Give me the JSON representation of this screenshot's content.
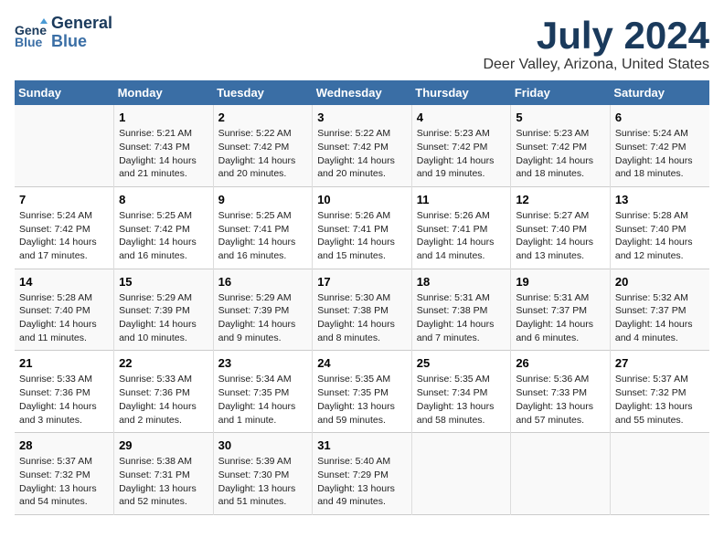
{
  "logo": {
    "line1": "General",
    "line2": "Blue"
  },
  "title": "July 2024",
  "location": "Deer Valley, Arizona, United States",
  "days_header": [
    "Sunday",
    "Monday",
    "Tuesday",
    "Wednesday",
    "Thursday",
    "Friday",
    "Saturday"
  ],
  "weeks": [
    [
      {
        "day": "",
        "sunrise": "",
        "sunset": "",
        "daylight": ""
      },
      {
        "day": "1",
        "sunrise": "Sunrise: 5:21 AM",
        "sunset": "Sunset: 7:43 PM",
        "daylight": "Daylight: 14 hours and 21 minutes."
      },
      {
        "day": "2",
        "sunrise": "Sunrise: 5:22 AM",
        "sunset": "Sunset: 7:42 PM",
        "daylight": "Daylight: 14 hours and 20 minutes."
      },
      {
        "day": "3",
        "sunrise": "Sunrise: 5:22 AM",
        "sunset": "Sunset: 7:42 PM",
        "daylight": "Daylight: 14 hours and 20 minutes."
      },
      {
        "day": "4",
        "sunrise": "Sunrise: 5:23 AM",
        "sunset": "Sunset: 7:42 PM",
        "daylight": "Daylight: 14 hours and 19 minutes."
      },
      {
        "day": "5",
        "sunrise": "Sunrise: 5:23 AM",
        "sunset": "Sunset: 7:42 PM",
        "daylight": "Daylight: 14 hours and 18 minutes."
      },
      {
        "day": "6",
        "sunrise": "Sunrise: 5:24 AM",
        "sunset": "Sunset: 7:42 PM",
        "daylight": "Daylight: 14 hours and 18 minutes."
      }
    ],
    [
      {
        "day": "7",
        "sunrise": "Sunrise: 5:24 AM",
        "sunset": "Sunset: 7:42 PM",
        "daylight": "Daylight: 14 hours and 17 minutes."
      },
      {
        "day": "8",
        "sunrise": "Sunrise: 5:25 AM",
        "sunset": "Sunset: 7:42 PM",
        "daylight": "Daylight: 14 hours and 16 minutes."
      },
      {
        "day": "9",
        "sunrise": "Sunrise: 5:25 AM",
        "sunset": "Sunset: 7:41 PM",
        "daylight": "Daylight: 14 hours and 16 minutes."
      },
      {
        "day": "10",
        "sunrise": "Sunrise: 5:26 AM",
        "sunset": "Sunset: 7:41 PM",
        "daylight": "Daylight: 14 hours and 15 minutes."
      },
      {
        "day": "11",
        "sunrise": "Sunrise: 5:26 AM",
        "sunset": "Sunset: 7:41 PM",
        "daylight": "Daylight: 14 hours and 14 minutes."
      },
      {
        "day": "12",
        "sunrise": "Sunrise: 5:27 AM",
        "sunset": "Sunset: 7:40 PM",
        "daylight": "Daylight: 14 hours and 13 minutes."
      },
      {
        "day": "13",
        "sunrise": "Sunrise: 5:28 AM",
        "sunset": "Sunset: 7:40 PM",
        "daylight": "Daylight: 14 hours and 12 minutes."
      }
    ],
    [
      {
        "day": "14",
        "sunrise": "Sunrise: 5:28 AM",
        "sunset": "Sunset: 7:40 PM",
        "daylight": "Daylight: 14 hours and 11 minutes."
      },
      {
        "day": "15",
        "sunrise": "Sunrise: 5:29 AM",
        "sunset": "Sunset: 7:39 PM",
        "daylight": "Daylight: 14 hours and 10 minutes."
      },
      {
        "day": "16",
        "sunrise": "Sunrise: 5:29 AM",
        "sunset": "Sunset: 7:39 PM",
        "daylight": "Daylight: 14 hours and 9 minutes."
      },
      {
        "day": "17",
        "sunrise": "Sunrise: 5:30 AM",
        "sunset": "Sunset: 7:38 PM",
        "daylight": "Daylight: 14 hours and 8 minutes."
      },
      {
        "day": "18",
        "sunrise": "Sunrise: 5:31 AM",
        "sunset": "Sunset: 7:38 PM",
        "daylight": "Daylight: 14 hours and 7 minutes."
      },
      {
        "day": "19",
        "sunrise": "Sunrise: 5:31 AM",
        "sunset": "Sunset: 7:37 PM",
        "daylight": "Daylight: 14 hours and 6 minutes."
      },
      {
        "day": "20",
        "sunrise": "Sunrise: 5:32 AM",
        "sunset": "Sunset: 7:37 PM",
        "daylight": "Daylight: 14 hours and 4 minutes."
      }
    ],
    [
      {
        "day": "21",
        "sunrise": "Sunrise: 5:33 AM",
        "sunset": "Sunset: 7:36 PM",
        "daylight": "Daylight: 14 hours and 3 minutes."
      },
      {
        "day": "22",
        "sunrise": "Sunrise: 5:33 AM",
        "sunset": "Sunset: 7:36 PM",
        "daylight": "Daylight: 14 hours and 2 minutes."
      },
      {
        "day": "23",
        "sunrise": "Sunrise: 5:34 AM",
        "sunset": "Sunset: 7:35 PM",
        "daylight": "Daylight: 14 hours and 1 minute."
      },
      {
        "day": "24",
        "sunrise": "Sunrise: 5:35 AM",
        "sunset": "Sunset: 7:35 PM",
        "daylight": "Daylight: 13 hours and 59 minutes."
      },
      {
        "day": "25",
        "sunrise": "Sunrise: 5:35 AM",
        "sunset": "Sunset: 7:34 PM",
        "daylight": "Daylight: 13 hours and 58 minutes."
      },
      {
        "day": "26",
        "sunrise": "Sunrise: 5:36 AM",
        "sunset": "Sunset: 7:33 PM",
        "daylight": "Daylight: 13 hours and 57 minutes."
      },
      {
        "day": "27",
        "sunrise": "Sunrise: 5:37 AM",
        "sunset": "Sunset: 7:32 PM",
        "daylight": "Daylight: 13 hours and 55 minutes."
      }
    ],
    [
      {
        "day": "28",
        "sunrise": "Sunrise: 5:37 AM",
        "sunset": "Sunset: 7:32 PM",
        "daylight": "Daylight: 13 hours and 54 minutes."
      },
      {
        "day": "29",
        "sunrise": "Sunrise: 5:38 AM",
        "sunset": "Sunset: 7:31 PM",
        "daylight": "Daylight: 13 hours and 52 minutes."
      },
      {
        "day": "30",
        "sunrise": "Sunrise: 5:39 AM",
        "sunset": "Sunset: 7:30 PM",
        "daylight": "Daylight: 13 hours and 51 minutes."
      },
      {
        "day": "31",
        "sunrise": "Sunrise: 5:40 AM",
        "sunset": "Sunset: 7:29 PM",
        "daylight": "Daylight: 13 hours and 49 minutes."
      },
      {
        "day": "",
        "sunrise": "",
        "sunset": "",
        "daylight": ""
      },
      {
        "day": "",
        "sunrise": "",
        "sunset": "",
        "daylight": ""
      },
      {
        "day": "",
        "sunrise": "",
        "sunset": "",
        "daylight": ""
      }
    ]
  ]
}
